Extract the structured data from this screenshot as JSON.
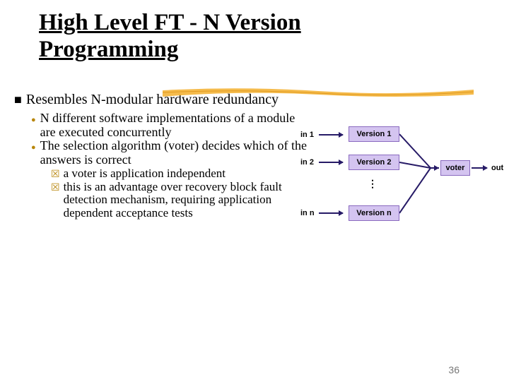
{
  "title": "High Level FT - N Version Programming",
  "bullets": {
    "l1": "Resembles N-modular hardware redundancy",
    "l2a": "N different software implementations of a module are executed concurrently",
    "l2b": "The selection algorithm (voter) decides which of the answers is correct",
    "l3a": "a voter is application independent",
    "l3b": "this is an advantage over recovery block fault detection mechanism, requiring application dependent acceptance tests"
  },
  "diagram": {
    "in1": "in 1",
    "in2": "in 2",
    "inn": "in n",
    "v1": "Version 1",
    "v2": "Version 2",
    "vn": "Version n",
    "voter": "voter",
    "out": "out"
  },
  "page": "36"
}
